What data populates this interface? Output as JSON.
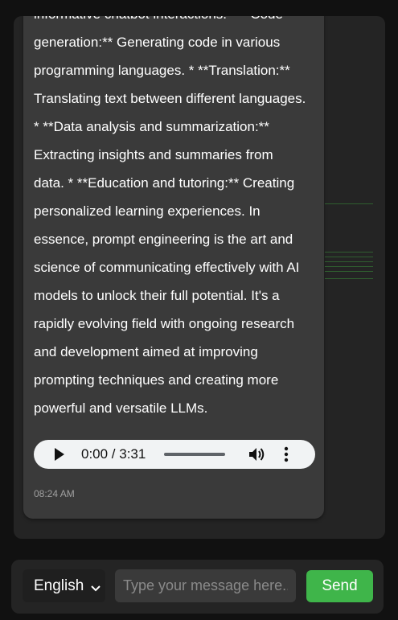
{
  "chat": {
    "message": {
      "lines": [
        "informative chatbot interactions. * **Code",
        "generation:** Generating code in various",
        "programming languages. * **Translation:**",
        "Translating text between different languages.",
        "* **Data analysis and summarization:**",
        "Extracting insights and summaries from",
        "data. * **Education and tutoring:** Creating",
        "personalized learning experiences. In",
        "essence, prompt engineering is the art and",
        "science of communicating effectively with AI",
        "models to unlock their full potential. It's a",
        "rapidly evolving field with ongoing research",
        "and development aimed at improving",
        "prompting techniques and creating more",
        "powerful and versatile LLMs."
      ],
      "audio": {
        "play_icon": "play-icon",
        "time": "0:00 / 3:31",
        "volume_icon": "volume-icon",
        "more_icon": "more-vertical-icon"
      },
      "timestamp": "08:24 AM"
    }
  },
  "composer": {
    "language": "English",
    "placeholder": "Type your message here...",
    "send_label": "Send"
  },
  "colors": {
    "send_button": "#3fb54a",
    "bubble": "#3a3a3a",
    "panel": "#242424",
    "background": "#111111"
  }
}
